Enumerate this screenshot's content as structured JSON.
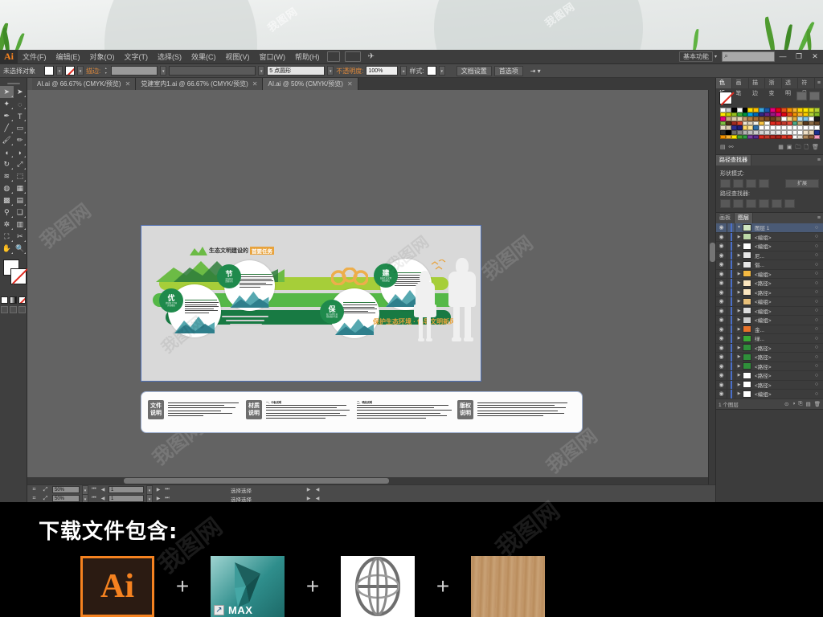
{
  "app": {
    "name": "Adobe Illustrator",
    "logo_text": "Ai",
    "workspace": "基本功能",
    "search_placeholder": "",
    "window_controls": {
      "minimize": "—",
      "restore": "❐",
      "close": "✕"
    }
  },
  "menu": [
    {
      "label": "文件(F)"
    },
    {
      "label": "编辑(E)"
    },
    {
      "label": "对象(O)"
    },
    {
      "label": "文字(T)"
    },
    {
      "label": "选择(S)"
    },
    {
      "label": "效果(C)"
    },
    {
      "label": "视图(V)"
    },
    {
      "label": "窗口(W)"
    },
    {
      "label": "帮助(H)"
    }
  ],
  "control_bar": {
    "selection_status": "未选择对象",
    "stroke_label": "描边:",
    "stroke_weight": "",
    "brush_def": "",
    "profile": "5 点圆形",
    "opacity_label": "不透明度:",
    "opacity_value": "100%",
    "style_label": "样式:",
    "doc_setup": "文档设置",
    "preferences": "首选项"
  },
  "tabs": [
    {
      "label": "AI.ai @ 66.67% (CMYK/预览)",
      "close": "✕",
      "active": false
    },
    {
      "label": "党建室内1.ai @ 66.67% (CMYK/预览)",
      "close": "✕",
      "active": false
    },
    {
      "label": "AI.ai @ 50% (CMYK/预览)",
      "close": "✕",
      "active": true
    }
  ],
  "toolbox": {
    "tools": [
      {
        "name": "selection-tool",
        "glyph": "➤"
      },
      {
        "name": "direct-selection-tool",
        "glyph": "➤"
      },
      {
        "name": "magic-wand-tool",
        "glyph": "✦"
      },
      {
        "name": "lasso-tool",
        "glyph": "◌"
      },
      {
        "name": "pen-tool",
        "glyph": "✒"
      },
      {
        "name": "type-tool",
        "glyph": "T"
      },
      {
        "name": "line-segment-tool",
        "glyph": "╱"
      },
      {
        "name": "rectangle-tool",
        "glyph": "▭"
      },
      {
        "name": "paintbrush-tool",
        "glyph": "🖌"
      },
      {
        "name": "pencil-tool",
        "glyph": "✏"
      },
      {
        "name": "blob-brush-tool",
        "glyph": "◖"
      },
      {
        "name": "eraser-tool",
        "glyph": "◗"
      },
      {
        "name": "rotate-tool",
        "glyph": "↻"
      },
      {
        "name": "scale-tool",
        "glyph": "⤢"
      },
      {
        "name": "width-tool",
        "glyph": "≋"
      },
      {
        "name": "free-transform-tool",
        "glyph": "⬚"
      },
      {
        "name": "shape-builder-tool",
        "glyph": "◍"
      },
      {
        "name": "perspective-grid-tool",
        "glyph": "▦"
      },
      {
        "name": "mesh-tool",
        "glyph": "▩"
      },
      {
        "name": "gradient-tool",
        "glyph": "▤"
      },
      {
        "name": "eyedropper-tool",
        "glyph": "⚲"
      },
      {
        "name": "blend-tool",
        "glyph": "❏"
      },
      {
        "name": "symbol-sprayer-tool",
        "glyph": "✲"
      },
      {
        "name": "column-graph-tool",
        "glyph": "▥"
      },
      {
        "name": "artboard-tool",
        "glyph": "⛶"
      },
      {
        "name": "slice-tool",
        "glyph": "✂"
      },
      {
        "name": "hand-tool",
        "glyph": "✋"
      },
      {
        "name": "zoom-tool",
        "glyph": "🔍"
      }
    ],
    "fill_stroke": {
      "fill": "#ffffff",
      "stroke": "none"
    },
    "color_modes": [
      "color",
      "gradient",
      "none"
    ],
    "draw_modes": [
      "draw-normal",
      "draw-behind",
      "draw-inside"
    ]
  },
  "panels": {
    "swatches": {
      "tabs": [
        "色板",
        "画笔",
        "描边",
        "渐变",
        "透明",
        "符号"
      ],
      "active_tab": "色板",
      "colors": [
        "#ffffff",
        "#cccccc",
        "#000000",
        "#ffffff",
        "#000000",
        "#ffdd00",
        "#ffc000",
        "#3ba7dd",
        "#1a57a8",
        "#e6007e",
        "#e30613",
        "#e94e1b",
        "#f39200",
        "#f9b233",
        "#ffd400",
        "#ffe800",
        "#d9e021",
        "#b2d235",
        "#ffe600",
        "#c8d400",
        "#95c11f",
        "#3aaa35",
        "#009640",
        "#009ee0",
        "#0069b4",
        "#312783",
        "#662483",
        "#951b81",
        "#e6007e",
        "#e30613",
        "#e94e1b",
        "#f39200",
        "#f9b233",
        "#ffcc00",
        "#b2d235",
        "#87bd25",
        "#e6007e",
        "#c6a87c",
        "#d9c9a8",
        "#e3d3b0",
        "#c49a6c",
        "#b07d3f",
        "#a56a2f",
        "#8f5b28",
        "#7b4a20",
        "#6b3f1c",
        "#8c6239",
        "#ffffff",
        "#f6d68a",
        "#e2a93c",
        "#b6e0f2",
        "#7fc4e8",
        "#ffffff",
        "#1b1b1b",
        "#7dbb42",
        "#4e2f16",
        "#a12b21",
        "#d7452b",
        "#f0e6d2",
        "#ded3bd",
        "#f2f0e6",
        "#f6c244",
        "#ffffff",
        "#e02b20",
        "#d92b20",
        "#c0392b",
        "#e74c3c",
        "#4aa886",
        "#c0a46c",
        "#5a3a1e",
        "#8a6a44",
        "#6b4a2a",
        "#e7dcc8",
        "#d8c9ad",
        "#2b2b8f",
        "#1f1f7a",
        "#ffd966",
        "#ffe699",
        "#2e6fa7",
        "#ffffff",
        "#ffffff",
        "#ffffff",
        "#ffffff",
        "#ffffff",
        "#ffffff",
        "#ffffff",
        "#ffffff",
        "#ffffff",
        "#ffffff",
        "#ffffff",
        "#2c2c2c",
        "#000000",
        "#6b6b6b",
        "#8a8a8a",
        "#b3b3b3",
        "#bfbfbf",
        "#c9c9c9",
        "#d2d2d2",
        "#dadada",
        "#e2e2e2",
        "#e9e9e9",
        "#efefef",
        "#f5f5f5",
        "#fafafa",
        "#ffffff",
        "#efe0c8",
        "#e5d3b3",
        "#1b2f8f",
        "#f39200",
        "#f9b233",
        "#ffe800",
        "#4aa32f",
        "#2f9e44",
        "#7b3fa0",
        "#5b2d8e",
        "#d92b20",
        "#c0392b",
        "#b5291f",
        "#a8241b",
        "#e03a2a",
        "#cf3526",
        "#ffffff",
        "#e6e0d6",
        "#b08a5e",
        "#8b5e3c",
        "#f49ac1"
      ]
    },
    "pathfinder": {
      "title": "路径查找器",
      "shape_modes_label": "形状模式:",
      "pathfinders_label": "路径查找器:",
      "expand_button": "扩展"
    },
    "layers": {
      "tabs": [
        "画板",
        "图层"
      ],
      "active_tab": "图层",
      "rows": [
        {
          "name": "图层 1",
          "selected": true,
          "expanded": true,
          "depth": 0,
          "thumb": "#cfe6c0"
        },
        {
          "name": "<编组>",
          "selected": false,
          "expanded": false,
          "depth": 1,
          "thumb": "#bcd9a8"
        },
        {
          "name": "<编组>",
          "selected": false,
          "expanded": false,
          "depth": 1,
          "thumb": "#ffffff"
        },
        {
          "name": "尼...",
          "selected": false,
          "expanded": false,
          "depth": 1,
          "thumb": "#e8e8e8"
        },
        {
          "name": "倡...",
          "selected": false,
          "expanded": false,
          "depth": 1,
          "thumb": "#e8e8e8"
        },
        {
          "name": "<编组>",
          "selected": false,
          "expanded": false,
          "depth": 1,
          "thumb": "#f4b942"
        },
        {
          "name": "<路径>",
          "selected": false,
          "expanded": false,
          "depth": 1,
          "thumb": "#fbe6c0"
        },
        {
          "name": "<路径>",
          "selected": false,
          "expanded": false,
          "depth": 1,
          "thumb": "#fbe6c0"
        },
        {
          "name": "<编组>",
          "selected": false,
          "expanded": false,
          "depth": 1,
          "thumb": "#e8c07a"
        },
        {
          "name": "<编组>",
          "selected": false,
          "expanded": false,
          "depth": 1,
          "thumb": "#dddddd"
        },
        {
          "name": "<编组>",
          "selected": false,
          "expanded": false,
          "depth": 1,
          "thumb": "#cccccc"
        },
        {
          "name": "金...",
          "selected": false,
          "expanded": false,
          "depth": 1,
          "thumb": "#e8732a"
        },
        {
          "name": "绿...",
          "selected": false,
          "expanded": false,
          "depth": 1,
          "thumb": "#3aaa35"
        },
        {
          "name": "<路径>",
          "selected": false,
          "expanded": false,
          "depth": 1,
          "thumb": "#2f8f3a"
        },
        {
          "name": "<路径>",
          "selected": false,
          "expanded": false,
          "depth": 1,
          "thumb": "#2f8f3a"
        },
        {
          "name": "<路径>",
          "selected": false,
          "expanded": false,
          "depth": 1,
          "thumb": "#2f8f3a"
        },
        {
          "name": "<路径>",
          "selected": false,
          "expanded": false,
          "depth": 1,
          "thumb": "#ffffff"
        },
        {
          "name": "<路径>",
          "selected": false,
          "expanded": false,
          "depth": 1,
          "thumb": "#ffffff"
        },
        {
          "name": "<编组>",
          "selected": false,
          "expanded": false,
          "depth": 1,
          "thumb": "#ffffff"
        }
      ],
      "footer_text": "1 个图层"
    }
  },
  "status_bar": {
    "zoom": "50%",
    "page": "1",
    "tool_status": "选择选择"
  },
  "artwork": {
    "title_dark": "生态文明建设的",
    "title_highlight": "首要任务",
    "slogan": "保护生态环境 · 倡导文明新风",
    "badges": [
      {
        "char": "优",
        "sub": "优化国土空间开发格局"
      },
      {
        "char": "节",
        "sub": "全面促进资源节约"
      },
      {
        "char": "保",
        "sub": "加大自然生态系统保护力度"
      },
      {
        "char": "建",
        "sub": "加强生态文明制度建设"
      }
    ],
    "colors": {
      "light_green": "#8cc63f",
      "mid_green": "#4caf50",
      "dark_green": "#1f7a3d",
      "deep_green": "#136b36",
      "orange": "#e8a33d",
      "teal": "#3e8e8e",
      "board_bg": "#d9d9d9"
    }
  },
  "description_board": {
    "sections": [
      {
        "badge": "文件\n说明",
        "heading": "",
        "lines": 5
      },
      {
        "badge": "材质\n说明",
        "heading": "一、中板说明",
        "lines": 6
      },
      {
        "badge": "",
        "heading": "二、喷绘说明",
        "lines": 6
      },
      {
        "badge": "版权\n说明",
        "heading": "",
        "lines": 6
      }
    ],
    "badge_file": "文件说明",
    "badge_material": "材质说明",
    "badge_copyright": "版权说明"
  },
  "download_banner": {
    "title": "下载文件包含:",
    "plus": "+",
    "items": [
      {
        "name": "ai-file-icon",
        "label": "Ai"
      },
      {
        "name": "3dsmax-file-icon",
        "label": "MAX"
      },
      {
        "name": "globe-icon",
        "label": ""
      },
      {
        "name": "wood-texture-icon",
        "label": ""
      }
    ]
  },
  "watermark": {
    "text": "我图网"
  }
}
